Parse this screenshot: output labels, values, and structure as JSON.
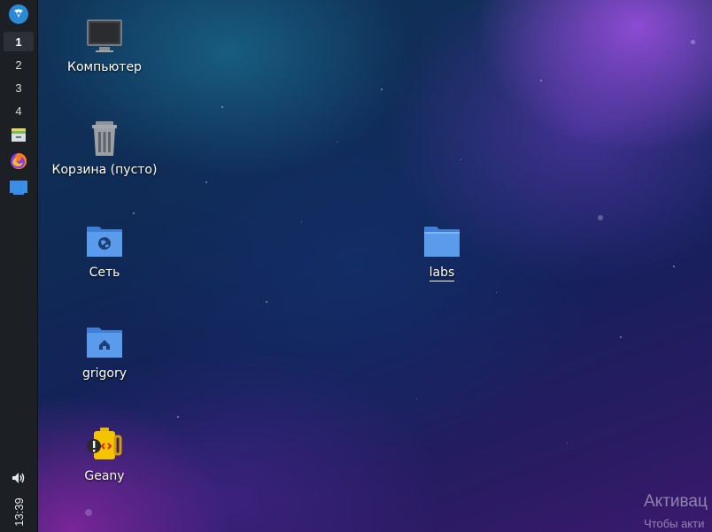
{
  "panel": {
    "workspaces": [
      "1",
      "2",
      "3",
      "4"
    ],
    "active_workspace": "1",
    "launchers": [
      {
        "name": "file-manager",
        "icon": "archive-icon"
      },
      {
        "name": "firefox",
        "icon": "firefox-icon"
      },
      {
        "name": "desktop",
        "icon": "show-desktop-icon"
      }
    ],
    "clock": "13:39",
    "volume_icon": "speaker-icon",
    "menu_icon": "distro-logo-icon"
  },
  "desktop": {
    "icons": [
      {
        "label": "Компьютер",
        "icon": "monitor-icon"
      },
      {
        "label": "Корзина (пусто)",
        "icon": "trash-icon"
      },
      {
        "label": "Сеть",
        "icon": "network-folder-icon"
      },
      {
        "label": "grigory",
        "icon": "home-folder-icon"
      },
      {
        "label": "Geany",
        "icon": "geany-icon"
      },
      {
        "label": "labs",
        "icon": "folder-icon"
      }
    ]
  },
  "watermark": {
    "line1": "Активац",
    "line2": "Чтобы акти"
  },
  "colors": {
    "folder_blue": "#5b9bec",
    "panel_bg": "#1c1f24",
    "accent": "#2b8ad6"
  }
}
